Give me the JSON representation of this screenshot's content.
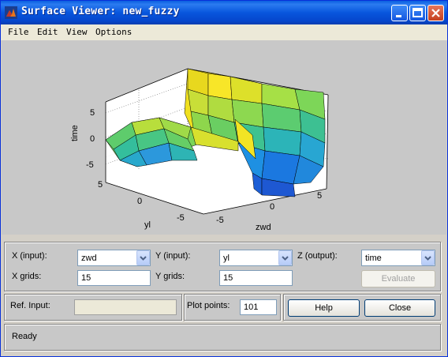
{
  "window": {
    "title": "Surface Viewer: new_fuzzy",
    "icons": [
      "matlab-icon",
      "minimize-icon",
      "maximize-icon",
      "close-icon"
    ]
  },
  "menu": [
    "File",
    "Edit",
    "View",
    "Options"
  ],
  "plot": {
    "zlabel": "time",
    "xlabel": "zwd",
    "ylabel": "yl",
    "z_ticks": [
      "5",
      "0",
      "-5"
    ],
    "x_ticks": [
      "-5",
      "0",
      "5"
    ],
    "y_ticks": [
      "5",
      "0",
      "-5"
    ]
  },
  "controls": {
    "x_input_label": "X (input):",
    "x_input_value": "zwd",
    "y_input_label": "Y (input):",
    "y_input_value": "yl",
    "z_output_label": "Z (output):",
    "z_output_value": "time",
    "x_grids_label": "X grids:",
    "x_grids_value": "15",
    "y_grids_label": "Y grids:",
    "y_grids_value": "15",
    "evaluate_label": "Evaluate",
    "ref_input_label": "Ref. Input:",
    "ref_input_value": "",
    "plot_points_label": "Plot points:",
    "plot_points_value": "101",
    "help_label": "Help",
    "close_label": "Close"
  },
  "status": "Ready",
  "colors": {
    "titlebar": "#0A5FE0",
    "panel_bg": "#C8C8C8",
    "plot_bg": "#FFFFFF"
  }
}
